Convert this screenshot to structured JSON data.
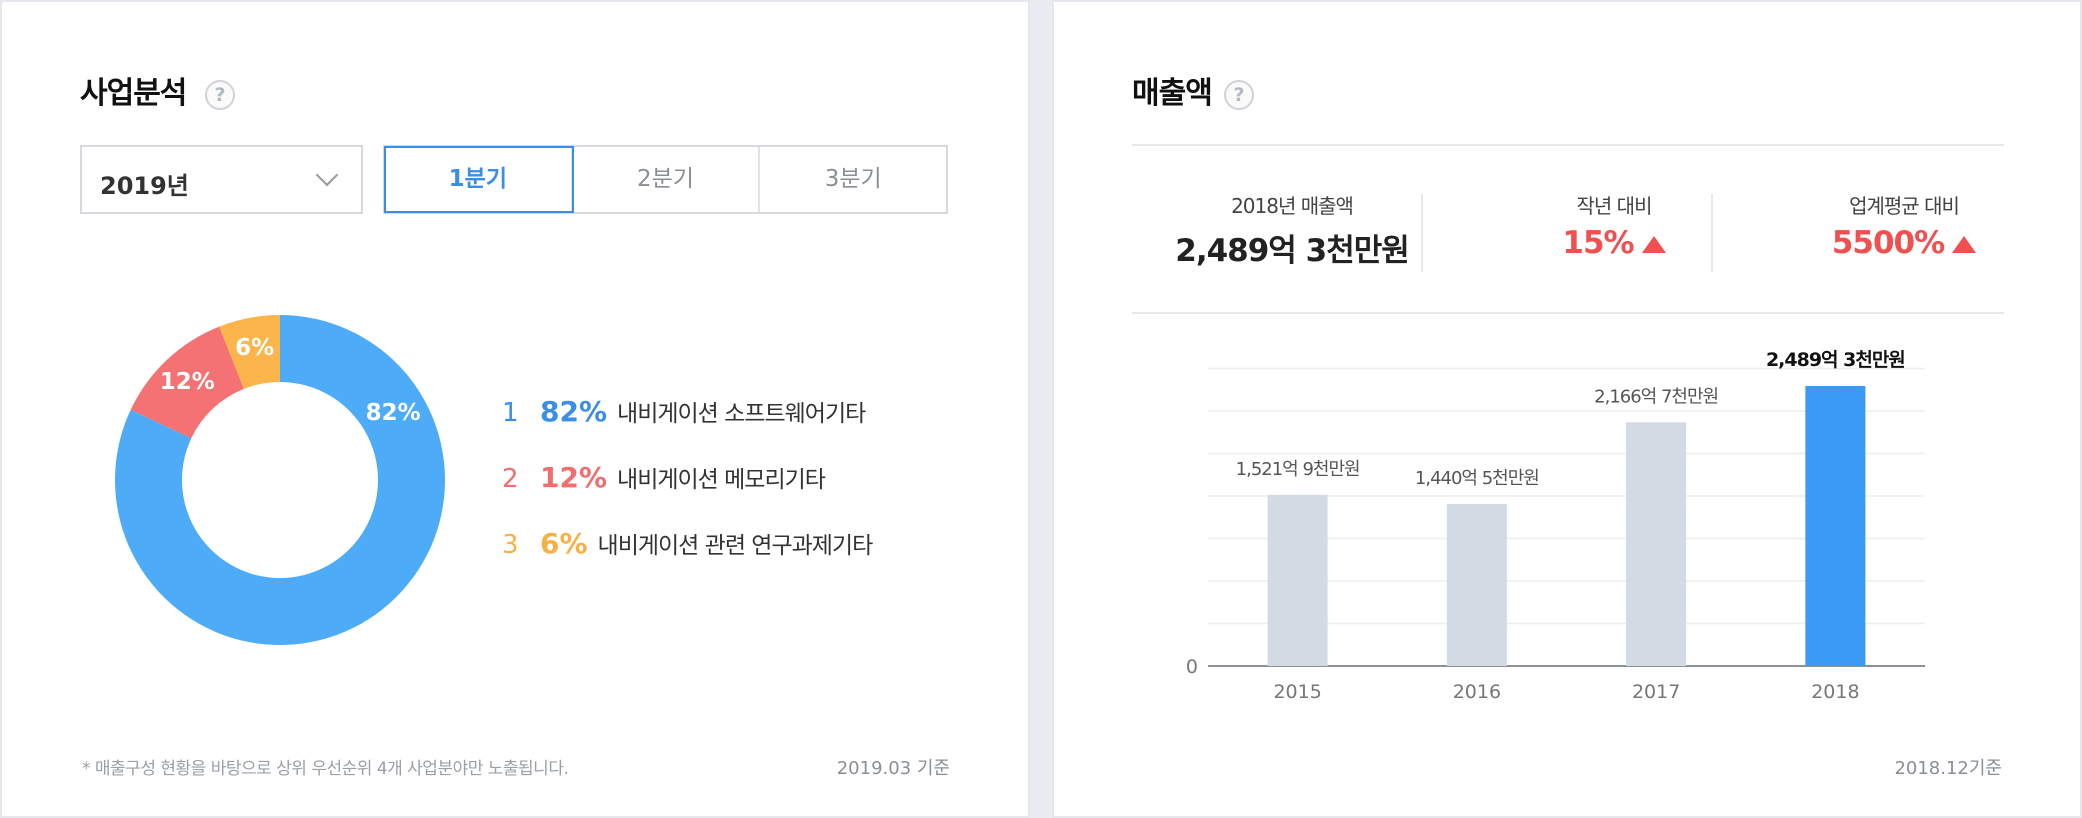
{
  "left": {
    "title": "사업분석",
    "help_icon": "?",
    "year_select": {
      "value": "2019년"
    },
    "quarter_tabs": [
      {
        "label": "1분기",
        "active": true
      },
      {
        "label": "2분기",
        "active": false
      },
      {
        "label": "3분기",
        "active": false
      }
    ],
    "legend": [
      {
        "rank": "1",
        "pct": "82%",
        "name": "내비게이션 소프트웨어기타",
        "color": "#3a8ee6"
      },
      {
        "rank": "2",
        "pct": "12%",
        "name": "내비게이션 메모리기타",
        "color": "#f06e6e"
      },
      {
        "rank": "3",
        "pct": "6%",
        "name": "내비게이션 관련 연구과제기타",
        "color": "#f7b144"
      }
    ],
    "footnote": "* 매출구성 현황을 바탕으로 상위 우선순위 4개 사업분야만 노출됩니다.",
    "asof": "2019.03 기준"
  },
  "right": {
    "title": "매출액",
    "help_icon": "?",
    "stats": [
      {
        "label": "2018년 매출액",
        "value": "2,489억 3천만원",
        "up": false
      },
      {
        "label": "작년 대비",
        "value": "15%",
        "up": true
      },
      {
        "label": "업계평균 대비",
        "value": "5500%",
        "up": true
      }
    ],
    "asof": "2018.12기준"
  },
  "chart_data": [
    {
      "type": "pie",
      "categories": [
        "내비게이션 소프트웨어기타",
        "내비게이션 메모리기타",
        "내비게이션 관련 연구과제기타"
      ],
      "values": [
        82,
        12,
        6
      ],
      "labels": [
        "82%",
        "12%",
        "6%"
      ],
      "colors": [
        "#4dabf7",
        "#f47174",
        "#fbb54a"
      ]
    },
    {
      "type": "bar",
      "categories": [
        "2015",
        "2016",
        "2017",
        "2018"
      ],
      "values": [
        1521.9,
        1440.5,
        2166.7,
        2489.3
      ],
      "data_labels": [
        "1,521억 9천만원",
        "1,440억 5천만원",
        "2,166억 7천만원",
        "2,489억 3천만원"
      ],
      "y_tick_labels": [
        "0"
      ],
      "ylim": [
        0,
        3100
      ],
      "grid": true,
      "colors": {
        "default": "#d3dae3",
        "highlight": "#3a9af5"
      },
      "highlight_index": 3
    }
  ]
}
